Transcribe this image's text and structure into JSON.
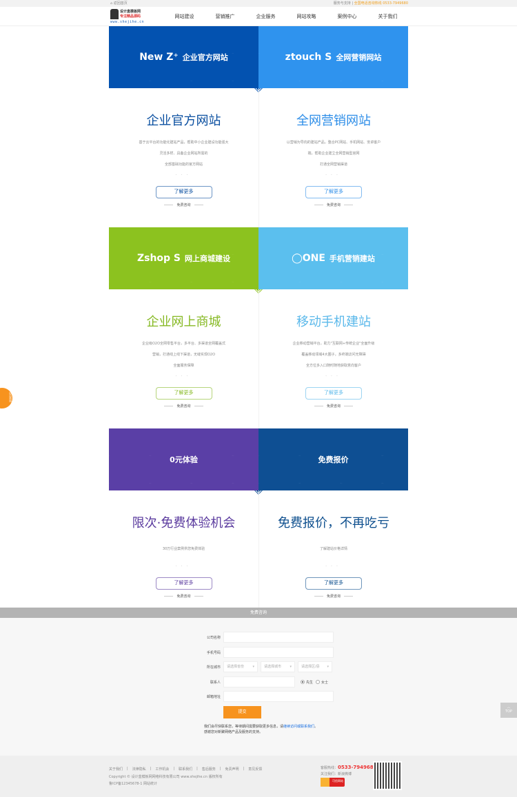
{
  "topbar": {
    "home": "返回首页",
    "support": "服务与支持",
    "hotline": "全国电话咨询热线 0533-7949680"
  },
  "logo": {
    "line1": "设计盒模板网",
    "line2": "专注精品源码",
    "url": "www.shejihe.cn"
  },
  "nav": [
    "网站建设",
    "营销推广",
    "企业服务",
    "网站攻略",
    "案例中心",
    "关于我们"
  ],
  "rows": [
    {
      "left": {
        "brand": "New Z⁺",
        "banner": "企业官方网站",
        "bg": "#0352b0",
        "title": "企业官方网站",
        "color": "#0a4fa0",
        "desc": [
          "基于云平台的功能化建站产品，帮助中小企业建设功能强大",
          "灵活多样、具备企业网站所需的",
          "全部基础功能的官方网站"
        ],
        "btn": "了解更多",
        "consult": "免费咨询"
      },
      "right": {
        "brand": "ztouch S",
        "banner": "全网营销网站",
        "bg": "#2f93ee",
        "title": "全网营销网站",
        "color": "#2e8ee8",
        "desc": [
          "以营销为导向的建站产品，整合PC网站、手机网站、安卓客户",
          "端，帮助企业建立全网营销型官网",
          "打通全网营销渠道"
        ],
        "btn": "了解更多",
        "consult": "免费咨询"
      },
      "arrow": "#0352b0"
    },
    {
      "left": {
        "brand": "Zshop S",
        "banner": "网上商城建设",
        "bg": "#8cc21f",
        "title": "企业网上商城",
        "color": "#86b923",
        "desc": [
          "企业级O2O全网零售平台，多平台、多渠道全网覆盖式",
          "营销，打通线上线下渠道，无缝实现O2O",
          "全面服务保障"
        ],
        "btn": "了解更多",
        "consult": "免费咨询"
      },
      "right": {
        "brand": "◯ONE",
        "banner": "手机营销建站",
        "bg": "#5bbfee",
        "title": "移动手机建站",
        "color": "#5ab8ea",
        "desc": [
          "企业移动营销平台，助力\"互联网+传统企业\"全面升级",
          "覆盖移动领域4大圈子，多终端访问无障碍",
          "全方位多入口随时随地获取意向客户"
        ],
        "btn": "了解更多",
        "consult": "免费咨询"
      },
      "arrow": "#8cc21f"
    },
    {
      "left": {
        "brand": "",
        "banner": "0元体验",
        "bg": "#5a3fa6",
        "title": "限次·免费体验机会",
        "color": "#5a3a9e",
        "desc": [
          "30万行业案例供您免费体验"
        ],
        "btn": "了解更多",
        "consult": "免费咨询"
      },
      "right": {
        "brand": "",
        "banner": "免费报价",
        "bg": "#0e4f93",
        "title": "免费报价，不再吃亏",
        "color": "#0e4f8e",
        "desc": [
          "了解建站价格详情"
        ],
        "btn": "了解更多",
        "consult": "免费咨询"
      },
      "arrow": "#0e4f93"
    }
  ],
  "form": {
    "bar": "免费咨询",
    "company": "公司名称",
    "phone": "手机号码",
    "city": "所在城市",
    "province_ph": "请选择省份",
    "city_ph": "请选择城市",
    "district_ph": "请选择区/县",
    "contact": "联系人",
    "mr": "先生",
    "ms": "女士",
    "email": "邮箱地址",
    "submit": "提交",
    "note1": "我们会尽快联系您，等待期间需要获取更多信息，请",
    "note_link1": "继续访问",
    "note_or": "或",
    "note_link2": "联系我们",
    "note_end": "。",
    "note2": "感谢您对新聚网络产品及服务的支持。"
  },
  "footer": {
    "links": [
      "关于我们",
      "法律隐私",
      "工作机会",
      "联系我们",
      "售后服务",
      "免责声明",
      "意见反馈"
    ],
    "copyright": "Copyright © 设计盒模板网网络科技有限公司 www.shejihe.cn 版权所有",
    "icp": "鲁ICP备12345678-1 网站统计",
    "hotline_label": "客服热线：",
    "hotline": "0533-7949680",
    "follow": "关注我们：新浪微博",
    "badge": "可信网站"
  },
  "float": {
    "left": "点击咨询",
    "top": "TOP"
  }
}
